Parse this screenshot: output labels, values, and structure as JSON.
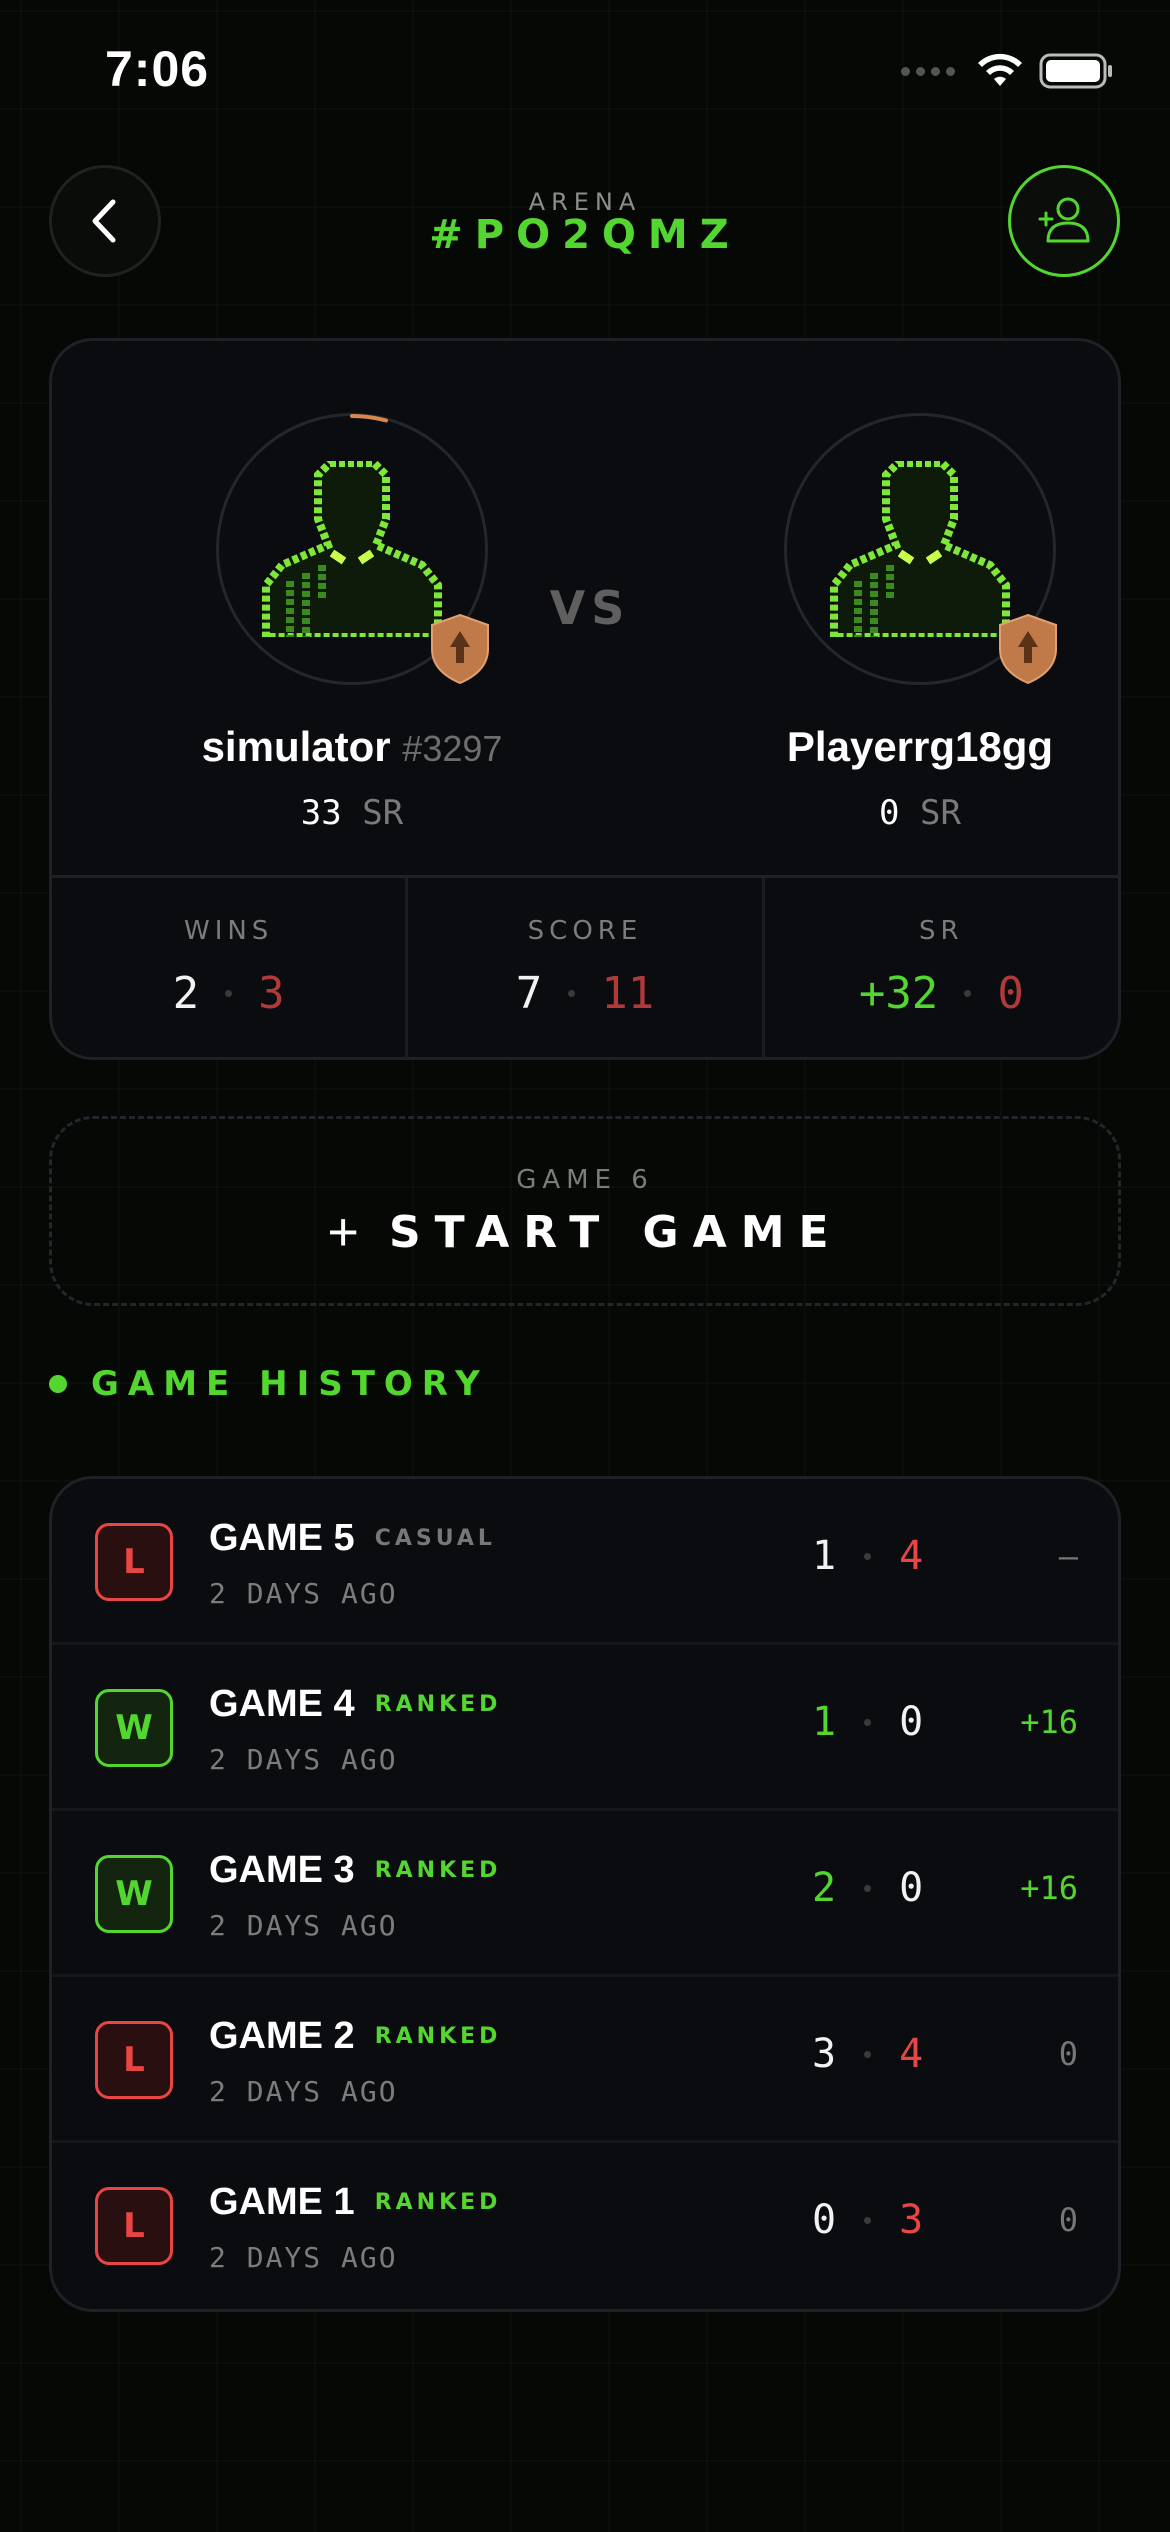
{
  "status_bar": {
    "time": "7:06"
  },
  "header": {
    "label": "ARENA",
    "code": "#PO2QMZ"
  },
  "match": {
    "vs_label": "VS",
    "player1": {
      "name": "simulator",
      "tag": "#3297",
      "sr_value": "33",
      "sr_unit": "SR"
    },
    "player2": {
      "name": "Playerrg18gg",
      "tag": "",
      "sr_value": "0",
      "sr_unit": "SR"
    },
    "stats": [
      {
        "label": "WINS",
        "left": "2",
        "right": "3"
      },
      {
        "label": "SCORE",
        "left": "7",
        "right": "11"
      },
      {
        "label": "SR",
        "left": "+32",
        "right": "0"
      }
    ]
  },
  "start_game": {
    "game_number": "GAME 6",
    "label": "START GAME"
  },
  "history": {
    "title": "GAME HISTORY",
    "games": [
      {
        "result": "L",
        "name": "GAME 5",
        "mode": "CASUAL",
        "time": "2 DAYS AGO",
        "score_left": "1",
        "score_right": "4",
        "delta": "—"
      },
      {
        "result": "W",
        "name": "GAME 4",
        "mode": "RANKED",
        "time": "2 DAYS AGO",
        "score_left": "1",
        "score_right": "0",
        "delta": "+16"
      },
      {
        "result": "W",
        "name": "GAME 3",
        "mode": "RANKED",
        "time": "2 DAYS AGO",
        "score_left": "2",
        "score_right": "0",
        "delta": "+16"
      },
      {
        "result": "L",
        "name": "GAME 2",
        "mode": "RANKED",
        "time": "2 DAYS AGO",
        "score_left": "3",
        "score_right": "4",
        "delta": "0"
      },
      {
        "result": "L",
        "name": "GAME 1",
        "mode": "RANKED",
        "time": "2 DAYS AGO",
        "score_left": "0",
        "score_right": "3",
        "delta": "0"
      }
    ]
  },
  "colors": {
    "accent": "#54d631",
    "loss": "#e84545",
    "card": "#0b0c10",
    "background": "#050805",
    "rank_badge": "#c07a4a"
  }
}
